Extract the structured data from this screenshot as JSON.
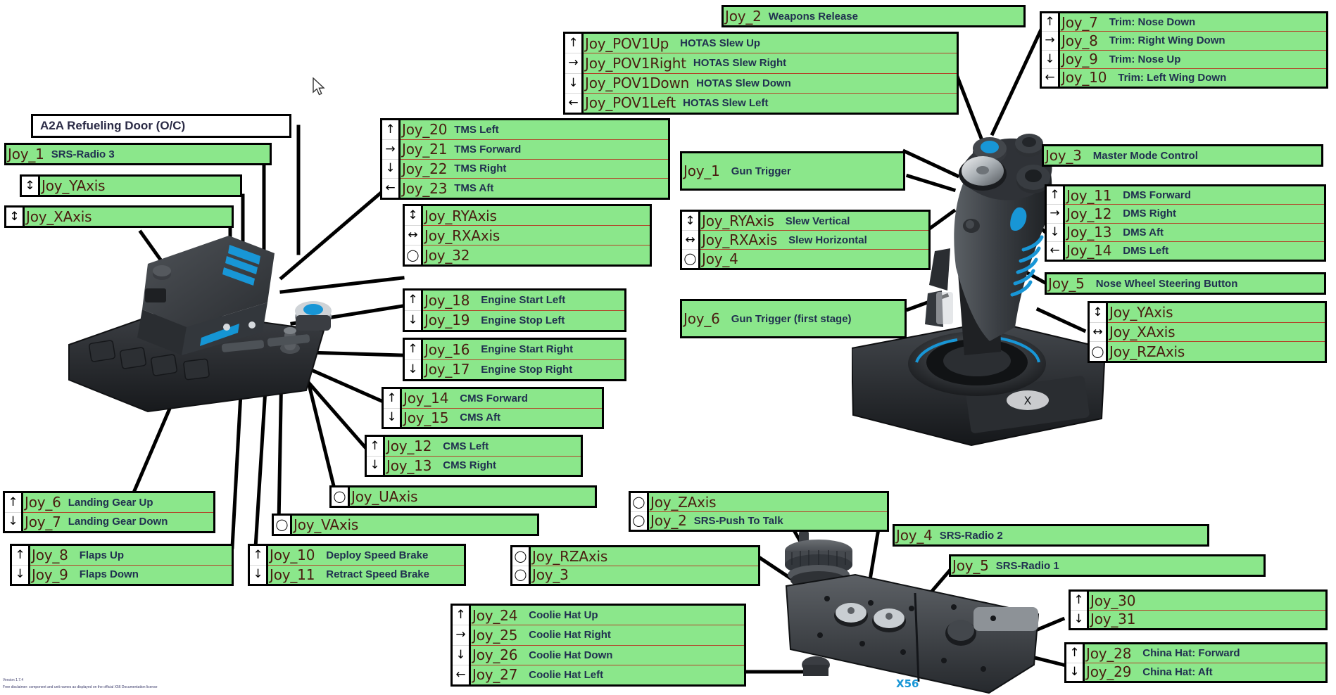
{
  "page": {
    "background": "#ffffff",
    "row_green": "#8BE78B",
    "row_border": "#B4432A",
    "code_color": "#4a1c10",
    "desc_color": "#203050",
    "box_border": "#000000"
  },
  "icons": {
    "up": "↑",
    "down": "↓",
    "left": "←",
    "right": "→",
    "updown": "↕",
    "leftright": "↔",
    "rotate": "◯",
    "circle": "◯"
  },
  "callouts": {
    "a2a_refueling": {
      "text": "A2A Refueling Door (O/C)"
    },
    "joy1_srs_radio3": {
      "code": "Joy_1",
      "desc": "SRS-Radio 3"
    },
    "joy_yaxis_left": {
      "code": "Joy_YAxis",
      "desc": ""
    },
    "joy_xaxis_left": {
      "code": "Joy_XAxis",
      "desc": ""
    },
    "tms": [
      {
        "code": "Joy_20",
        "desc": "TMS Left"
      },
      {
        "code": "Joy_21",
        "desc": "TMS Forward"
      },
      {
        "code": "Joy_22",
        "desc": "TMS Right"
      },
      {
        "code": "Joy_23",
        "desc": "TMS Aft"
      }
    ],
    "throttle_slew": [
      {
        "code": "Joy_RYAxis",
        "desc": ""
      },
      {
        "code": "Joy_RXAxis",
        "desc": ""
      },
      {
        "code": "Joy_32",
        "desc": ""
      }
    ],
    "engine_left": [
      {
        "code": "Joy_18",
        "desc": "Engine Start Left"
      },
      {
        "code": "Joy_19",
        "desc": "Engine Stop Left"
      }
    ],
    "engine_right": [
      {
        "code": "Joy_16",
        "desc": "Engine Start Right"
      },
      {
        "code": "Joy_17",
        "desc": "Engine Stop Right"
      }
    ],
    "cms_fwd_aft": [
      {
        "code": "Joy_14",
        "desc": "CMS Forward"
      },
      {
        "code": "Joy_15",
        "desc": "CMS Aft"
      }
    ],
    "cms_left_right": [
      {
        "code": "Joy_12",
        "desc": "CMS Left"
      },
      {
        "code": "Joy_13",
        "desc": "CMS Right"
      }
    ],
    "joy_uaxis": {
      "code": "Joy_UAxis",
      "desc": ""
    },
    "joy_vaxis": {
      "code": "Joy_VAxis",
      "desc": ""
    },
    "landing_gear": [
      {
        "code": "Joy_6",
        "desc": "Landing Gear Up"
      },
      {
        "code": "Joy_7",
        "desc": "Landing Gear Down"
      }
    ],
    "flaps": [
      {
        "code": "Joy_8",
        "desc": "Flaps Up"
      },
      {
        "code": "Joy_9",
        "desc": "Flaps Down"
      }
    ],
    "speed_brake": [
      {
        "code": "Joy_10",
        "desc": "Deploy Speed Brake"
      },
      {
        "code": "Joy_11",
        "desc": "Retract Speed Brake"
      }
    ],
    "rzaxis_joy3": [
      {
        "code": "Joy_RZAxis",
        "desc": ""
      },
      {
        "code": "Joy_3",
        "desc": ""
      }
    ],
    "coolie_hat": [
      {
        "code": "Joy_24",
        "desc": "Coolie Hat Up"
      },
      {
        "code": "Joy_25",
        "desc": "Coolie Hat Right"
      },
      {
        "code": "Joy_26",
        "desc": "Coolie Hat Down"
      },
      {
        "code": "Joy_27",
        "desc": "Coolie Hat Left"
      }
    ],
    "joy2_weapons": {
      "code": "Joy_2",
      "desc": "Weapons Release"
    },
    "pov1": [
      {
        "code": "Joy_POV1Up",
        "desc": "HOTAS Slew Up"
      },
      {
        "code": "Joy_POV1Right",
        "desc": "HOTAS Slew Right"
      },
      {
        "code": "Joy_POV1Down",
        "desc": "HOTAS Slew Down"
      },
      {
        "code": "Joy_POV1Left",
        "desc": "HOTAS Slew Left"
      }
    ],
    "joy1_gun_trigger": {
      "code": "Joy_1",
      "desc": "Gun Trigger"
    },
    "stick_slew": [
      {
        "code": "Joy_RYAxis",
        "desc": "Slew Vertical"
      },
      {
        "code": "Joy_RXAxis",
        "desc": "Slew Horizontal"
      },
      {
        "code": "Joy_4",
        "desc": ""
      }
    ],
    "joy6_gun_trigger_first": {
      "code": "Joy_6",
      "desc": "Gun Trigger (first stage)"
    },
    "trim": [
      {
        "code": "Joy_7",
        "desc": "Trim: Nose Down"
      },
      {
        "code": "Joy_8",
        "desc": "Trim: Right Wing Down"
      },
      {
        "code": "Joy_9",
        "desc": "Trim: Nose Up"
      },
      {
        "code": "Joy_10",
        "desc": "Trim: Left Wing Down"
      }
    ],
    "joy3_master_mode": {
      "code": "Joy_3",
      "desc": "Master Mode Control"
    },
    "dms": [
      {
        "code": "Joy_11",
        "desc": "DMS Forward"
      },
      {
        "code": "Joy_12",
        "desc": "DMS Right"
      },
      {
        "code": "Joy_13",
        "desc": "DMS Aft"
      },
      {
        "code": "Joy_14",
        "desc": "DMS Left"
      }
    ],
    "joy5_nose_wheel": {
      "code": "Joy_5",
      "desc": "Nose Wheel Steering Button"
    },
    "stick_axes": [
      {
        "code": "Joy_YAxis",
        "desc": ""
      },
      {
        "code": "Joy_XAxis",
        "desc": ""
      },
      {
        "code": "Joy_RZAxis",
        "desc": ""
      }
    ],
    "joy_zaxis_ptt": [
      {
        "code": "Joy_ZAxis",
        "desc": ""
      },
      {
        "code": "Joy_2",
        "desc": "SRS-Push To Talk"
      }
    ],
    "joy4_srs_radio2": {
      "code": "Joy_4",
      "desc": "SRS-Radio 2"
    },
    "joy5_srs_radio1": {
      "code": "Joy_5",
      "desc": "SRS-Radio 1"
    },
    "joy30_31": [
      {
        "code": "Joy_30",
        "desc": ""
      },
      {
        "code": "Joy_31",
        "desc": ""
      }
    ],
    "china_hat": [
      {
        "code": "Joy_28",
        "desc": "China Hat: Forward"
      },
      {
        "code": "Joy_29",
        "desc": "China Hat: Aft"
      }
    ]
  },
  "footer": {
    "line1": "Version 1.7.4",
    "line2": "Free disclaimer: component and unit names as displayed on the official X56 Documentation license"
  }
}
